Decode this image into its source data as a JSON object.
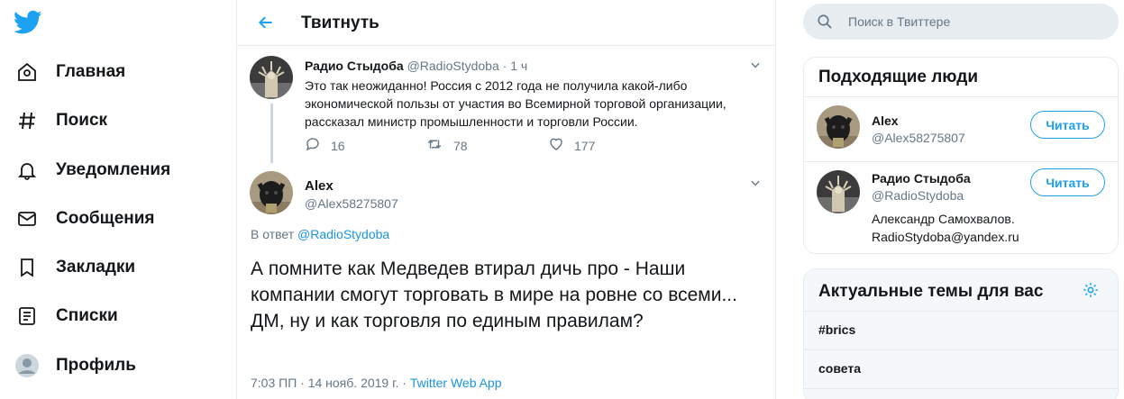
{
  "colors": {
    "accent": "#1da1f2",
    "link": "#1b95e0",
    "text": "#14171a",
    "muted": "#657786",
    "border": "#e6ecf0"
  },
  "nav": {
    "logo_icon": "twitter-bird-icon",
    "items": [
      {
        "label": "Главная",
        "icon": "home-icon"
      },
      {
        "label": "Поиск",
        "icon": "hashtag-icon"
      },
      {
        "label": "Уведомления",
        "icon": "bell-icon"
      },
      {
        "label": "Сообщения",
        "icon": "envelope-icon"
      },
      {
        "label": "Закладки",
        "icon": "bookmark-icon"
      },
      {
        "label": "Списки",
        "icon": "list-icon"
      },
      {
        "label": "Профиль",
        "icon": "avatar-icon"
      }
    ]
  },
  "header": {
    "title": "Твитнуть",
    "back_icon": "arrow-left-icon"
  },
  "original_tweet": {
    "author_name": "Радио Стыдоба",
    "author_handle": "@RadioStydoba",
    "separator": "·",
    "time": "1 ч",
    "text": "Это так неожиданно! Россия с 2012 года не получила какой-либо экономической пользы от участия во Всемирной торговой организации, рассказал министр промышленности и торговли России.",
    "replies": "16",
    "retweets": "78",
    "likes": "177"
  },
  "reply_tweet": {
    "author_name": "Alex",
    "author_handle": "@Alex58275807",
    "in_reply_prefix": "В ответ",
    "in_reply_handle": "@RadioStydoba",
    "text": "А помните как Медведев втирал дичь про - Наши компании смогут торговать в мире на ровне со всеми...\nДМ, ну и как торговля по единым правилам?",
    "timestamp": "7:03 ПП · 14 нояб. 2019 г. · ",
    "source": "Twitter Web App"
  },
  "search": {
    "placeholder": "Поиск в Твиттере"
  },
  "who_to_follow": {
    "title": "Подходящие люди",
    "people": [
      {
        "name": "Alex",
        "handle": "@Alex58275807",
        "bio": "",
        "button": "Читать"
      },
      {
        "name": "Радио Стыдоба",
        "handle": "@RadioStydoba",
        "bio": "Александр Самохвалов. RadioStydoba@yandex.ru",
        "button": "Читать"
      }
    ]
  },
  "trends": {
    "title": "Актуальные темы для вас",
    "items": [
      "#brics",
      "совета"
    ]
  }
}
